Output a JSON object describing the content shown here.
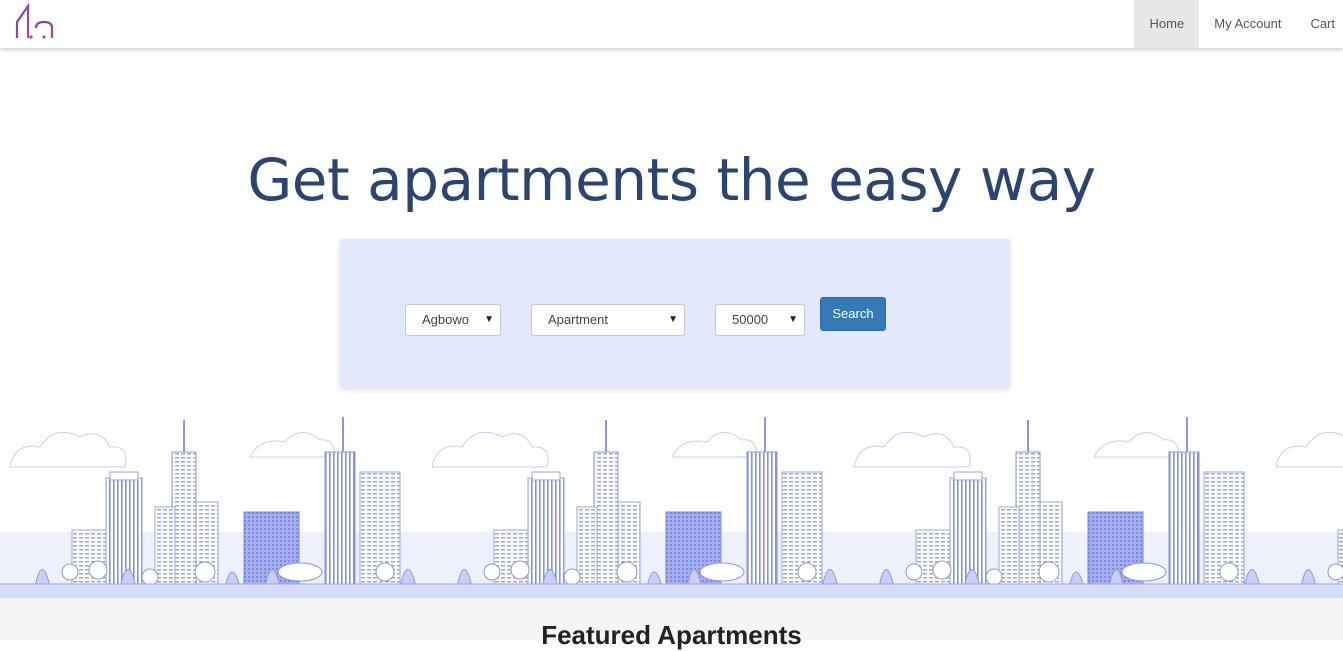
{
  "nav": {
    "items": [
      {
        "label": "Home",
        "active": true
      },
      {
        "label": "My Account"
      },
      {
        "label": "Cart"
      }
    ]
  },
  "hero": {
    "title": "Get apartments the easy way"
  },
  "search": {
    "location": "Agbowo",
    "type": "Apartment",
    "price": "50000",
    "button_label": "Search"
  },
  "featured": {
    "title": "Featured Apartments"
  },
  "colors": {
    "title": "#2b4470",
    "panel": "#e3e8fc",
    "button": "#337ab7",
    "logo_gradient": [
      "#5a4fcf",
      "#c0417b"
    ]
  }
}
